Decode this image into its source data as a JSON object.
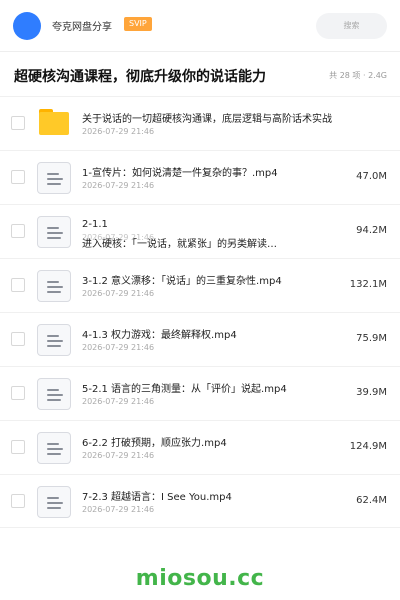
{
  "header": {
    "app_title": "夸克网盘分享",
    "badge": "SVIP",
    "search_placeholder": "搜索"
  },
  "page": {
    "title": "超硬核沟通课程，彻底升级你的说话能力",
    "meta": "共 28 项 · 2.4G"
  },
  "folder": {
    "name": "关于说话的一切超硬核沟通课，底层逻辑与高阶话术实战",
    "date": "2026-07-29 21:46"
  },
  "overlap_item": {
    "name": "2-1.1",
    "name2": "进入硬核：「一说话，就紧张」的另类解读…",
    "date": "2026-07-29 21:46",
    "size": "94.2M"
  },
  "files": [
    {
      "name": "1-宣传片：如何说清楚一件复杂的事？.mp4",
      "date": "2026-07-29 21:46",
      "size": "47.0M"
    },
    {
      "name": "3-1.2 意义漂移：「说话」的三重复杂性.mp4",
      "date": "2026-07-29 21:46",
      "size": "132.1M"
    },
    {
      "name": "4-1.3 权力游戏：最终解释权.mp4",
      "date": "2026-07-29 21:46",
      "size": "75.9M"
    },
    {
      "name": "5-2.1 语言的三角测量：从「评价」说起.mp4",
      "date": "2026-07-29 21:46",
      "size": "39.9M"
    },
    {
      "name": "6-2.2 打破预期，顺应张力.mp4",
      "date": "2026-07-29 21:46",
      "size": "124.9M"
    },
    {
      "name": "7-2.3 超越语言：I See You.mp4",
      "date": "2026-07-29 21:46",
      "size": "62.4M"
    }
  ],
  "watermark": "miosou.cc"
}
